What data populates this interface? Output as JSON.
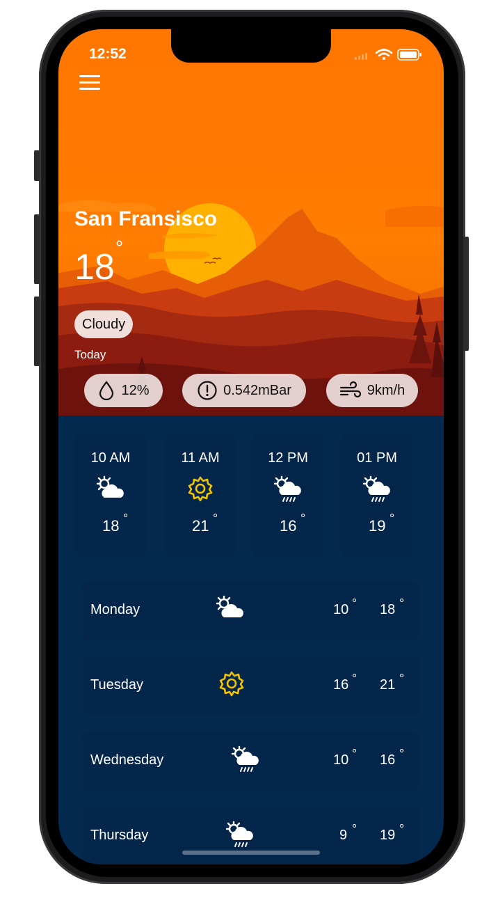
{
  "status_bar": {
    "time": "12:52"
  },
  "location": {
    "city": "San Fransisco"
  },
  "current": {
    "temperature": "18",
    "degree_symbol": "°",
    "condition": "Cloudy",
    "period_label": "Today"
  },
  "stats": {
    "humidity": {
      "value": "12%",
      "icon": "droplet-icon"
    },
    "pressure": {
      "value": "0.542mBar",
      "icon": "alert-circle-icon"
    },
    "wind": {
      "value": "9km/h",
      "icon": "wind-icon"
    }
  },
  "hourly": [
    {
      "time": "10 AM",
      "icon": "sun-behind-cloud-icon",
      "temp": "18",
      "deg": "°"
    },
    {
      "time": "11 AM",
      "icon": "sun-icon",
      "temp": "21",
      "deg": "°"
    },
    {
      "time": "12 PM",
      "icon": "sun-cloud-rain-icon",
      "temp": "16",
      "deg": "°"
    },
    {
      "time": "01 PM",
      "icon": "sun-cloud-rain-icon",
      "temp": "19",
      "deg": "°"
    }
  ],
  "daily": [
    {
      "day": "Monday",
      "icon": "sun-behind-cloud-icon",
      "low": "10",
      "high": "18",
      "deg": "°"
    },
    {
      "day": "Tuesday",
      "icon": "sun-icon",
      "low": "16",
      "high": "21",
      "deg": "°"
    },
    {
      "day": "Wednesday",
      "icon": "sun-cloud-rain-icon",
      "low": "10",
      "high": "16",
      "deg": "°"
    },
    {
      "day": "Thursday",
      "icon": "sun-cloud-rain-icon",
      "low": "9",
      "high": "19",
      "deg": "°"
    }
  ],
  "colors": {
    "sky": "#ff7a00",
    "sun": "#ffb000",
    "content_background": "#03294f",
    "card_background": "#04264a",
    "sun_icon": "#f5c400"
  }
}
